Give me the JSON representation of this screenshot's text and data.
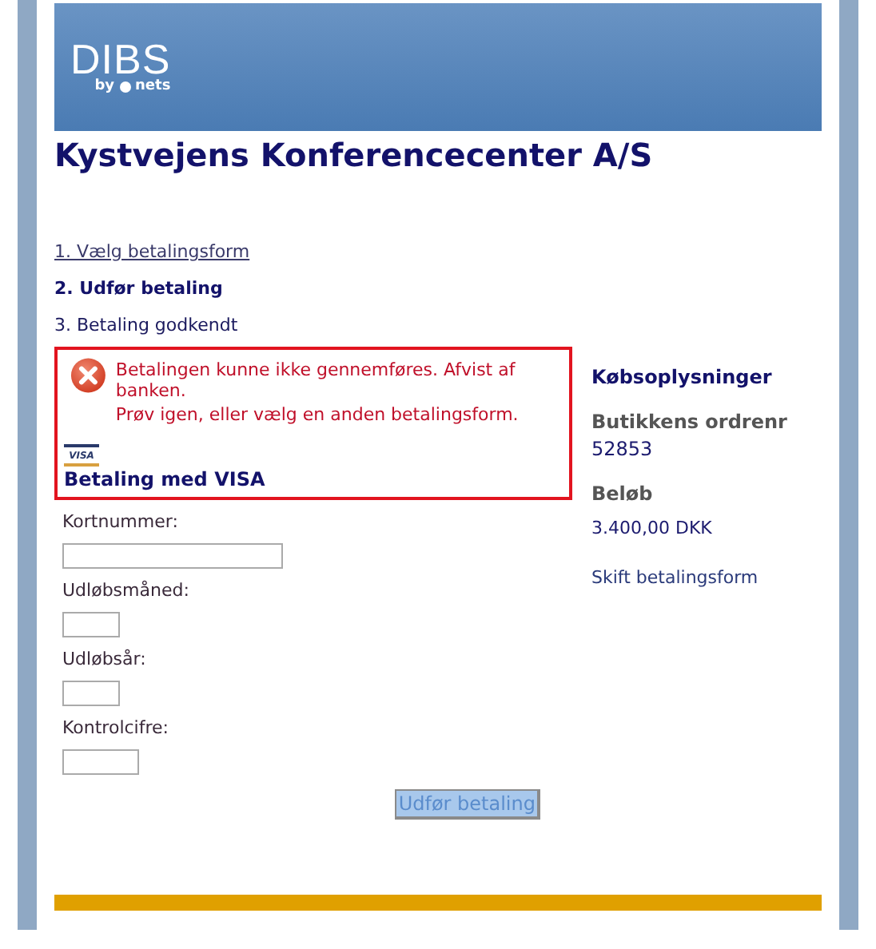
{
  "header": {
    "logo": {
      "word": "DIBS",
      "by": "by",
      "brand": "nets"
    }
  },
  "merchant": {
    "name": "Kystvejens Konferencecenter A/S"
  },
  "steps": [
    {
      "label": "1. Vælg betalingsform",
      "kind": "link"
    },
    {
      "label": "2. Udfør betaling",
      "kind": "current"
    },
    {
      "label": "3. Betaling godkendt",
      "kind": "pending"
    }
  ],
  "error": {
    "lines": [
      "Betalingen kunne ikke gennemføres. Afvist af banken.",
      "Prøv igen, eller vælg en anden betalingsform."
    ],
    "card_badge": "VISA",
    "method": "Betaling med VISA"
  },
  "form": {
    "fields": [
      {
        "label": "Kortnummer:",
        "kind": "long"
      },
      {
        "label": "Udløbsmåned:",
        "kind": "short"
      },
      {
        "label": "Udløbsår:",
        "kind": "short"
      },
      {
        "label": "Kontrolcifre:",
        "kind": "medium"
      }
    ],
    "submit": {
      "label": "Udfør betaling",
      "disabled": true
    }
  },
  "summary": {
    "title": "Købsoplysninger",
    "order_label": "Butikkens ordrenr",
    "order_number": "52853",
    "amount_label": "Beløb",
    "amount": "3.400,00 DKK",
    "change_link": "Skift betalingsform"
  }
}
